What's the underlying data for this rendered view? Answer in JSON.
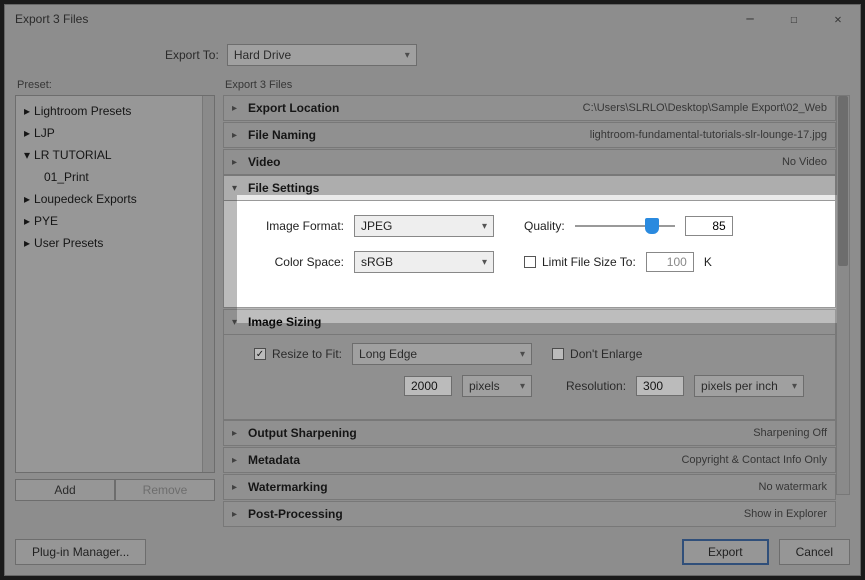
{
  "window": {
    "title": "Export 3 Files"
  },
  "export_to": {
    "label": "Export To:",
    "value": "Hard Drive"
  },
  "preset": {
    "label": "Preset:",
    "items": [
      {
        "label": "Lightroom Presets",
        "expanded": false
      },
      {
        "label": "LJP",
        "expanded": false
      },
      {
        "label": "LR TUTORIAL",
        "expanded": true
      },
      {
        "label": "01_Print",
        "child": true
      },
      {
        "label": "Loupedeck Exports",
        "expanded": false
      },
      {
        "label": "PYE",
        "expanded": false
      },
      {
        "label": "User Presets",
        "expanded": false
      }
    ],
    "add": "Add",
    "remove": "Remove"
  },
  "right_label": "Export 3 Files",
  "panels": {
    "export_location": {
      "title": "Export Location",
      "summary": "C:\\Users\\SLRLO\\Desktop\\Sample Export\\02_Web"
    },
    "file_naming": {
      "title": "File Naming",
      "summary": "lightroom-fundamental-tutorials-slr-lounge-17.jpg"
    },
    "video": {
      "title": "Video",
      "summary": "No Video"
    },
    "file_settings": {
      "title": "File Settings",
      "image_format_label": "Image Format:",
      "image_format_value": "JPEG",
      "quality_label": "Quality:",
      "quality_value": "85",
      "color_space_label": "Color Space:",
      "color_space_value": "sRGB",
      "limit_label": "Limit File Size To:",
      "limit_value": "100",
      "limit_unit": "K"
    },
    "image_sizing": {
      "title": "Image Sizing",
      "resize_label": "Resize to Fit:",
      "resize_value": "Long Edge",
      "dont_enlarge": "Don't Enlarge",
      "size_value": "2000",
      "size_unit": "pixels",
      "resolution_label": "Resolution:",
      "resolution_value": "300",
      "resolution_unit": "pixels per inch"
    },
    "output_sharpening": {
      "title": "Output Sharpening",
      "summary": "Sharpening Off"
    },
    "metadata": {
      "title": "Metadata",
      "summary": "Copyright & Contact Info Only"
    },
    "watermarking": {
      "title": "Watermarking",
      "summary": "No watermark"
    },
    "post_processing": {
      "title": "Post-Processing",
      "summary": "Show in Explorer"
    }
  },
  "footer": {
    "plugin": "Plug-in Manager...",
    "export": "Export",
    "cancel": "Cancel"
  }
}
